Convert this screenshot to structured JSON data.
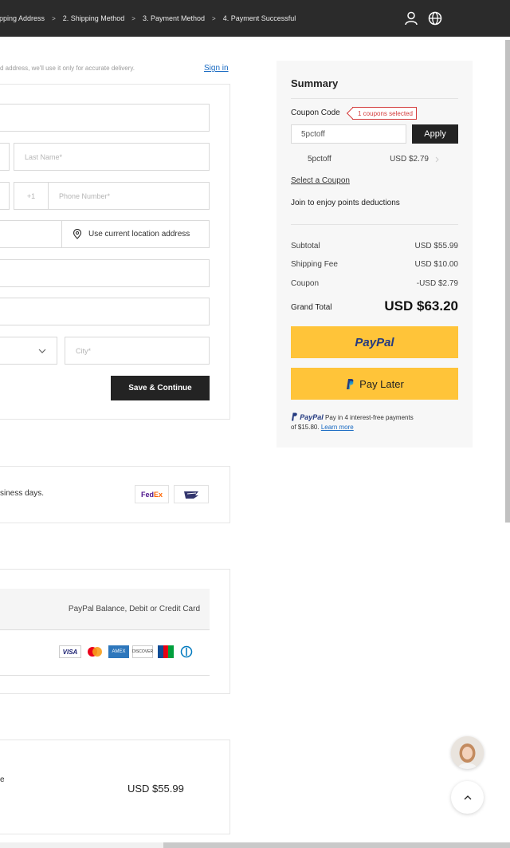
{
  "steps": [
    {
      "label": "Shipping Address"
    },
    {
      "label": "2. Shipping Method"
    },
    {
      "label": "3. Payment Method"
    },
    {
      "label": "4. Payment Successful"
    }
  ],
  "step_separator": ">",
  "form": {
    "hint": "d address, we'll use it only for accurate delivery.",
    "sign_in": "Sign in",
    "last_name_placeholder": "Last Name*",
    "phone_code": "+1",
    "phone_placeholder": "Phone Number*",
    "location_label": "Use current location address",
    "city_placeholder": "City*",
    "save_label": "Save & Continue"
  },
  "shipping": {
    "text": "siness days.",
    "carriers": [
      "FedEx",
      "USPS"
    ]
  },
  "payment": {
    "option_text": "PayPal Balance, Debit or Credit Card",
    "cards": [
      "visa-icon",
      "mastercard-icon",
      "amex-icon",
      "discover-icon",
      "jcb-icon",
      "diners-icon"
    ]
  },
  "order": {
    "snippet": "e",
    "amount": "USD $55.99"
  },
  "summary": {
    "title": "Summary",
    "coupon_label": "Coupon Code",
    "coupon_badge": "1 coupons selected",
    "coupon_value": "5pctoff",
    "apply_label": "Apply",
    "applied_code": "5pctoff",
    "applied_amount": "USD $2.79",
    "select_coupon": "Select a Coupon",
    "points_text": "Join to enjoy points deductions",
    "rows": [
      {
        "label": "Subtotal",
        "value": "USD $55.99"
      },
      {
        "label": "Shipping Fee",
        "value": "USD $10.00"
      },
      {
        "label": "Coupon",
        "value": "-USD $2.79"
      }
    ],
    "grand_total_label": "Grand Total",
    "grand_total_value": "USD $63.20",
    "paypal_label": "PayPal",
    "pay_later_label": "Pay Later",
    "paypal_small": "PayPal",
    "installment_text": "Pay in 4 interest-free payments",
    "installment_text2": "of $15.80.",
    "learn_more": "Learn more"
  },
  "colors": {
    "topbar": "#2b2b2b",
    "accent_link": "#1769c2",
    "paypal_yellow": "#ffc439",
    "badge_red": "#d43c3c"
  }
}
